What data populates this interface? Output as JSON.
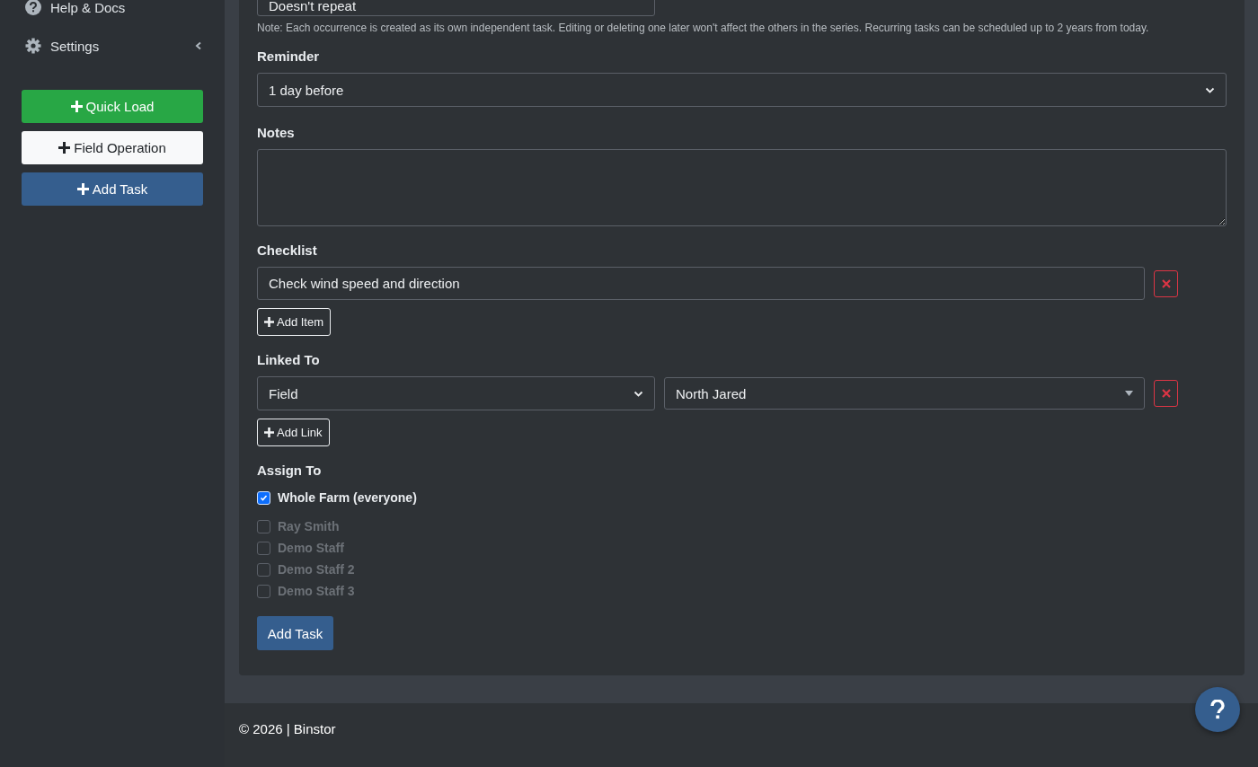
{
  "sidebar": {
    "items": [
      {
        "label": "Help & Docs"
      },
      {
        "label": "Settings",
        "expanded": false
      }
    ],
    "buttons": [
      {
        "label": "Quick Load",
        "kind": "success"
      },
      {
        "label": "Field Operation",
        "kind": "light"
      },
      {
        "label": "Add Task",
        "kind": "primary"
      }
    ]
  },
  "form": {
    "repeat": {
      "value": "Doesn't repeat"
    },
    "repeat_note": "Note: Each occurrence is created as its own independent task. Editing or deleting one later won't affect the others in the series. Recurring tasks can be scheduled up to 2 years from today.",
    "reminder": {
      "label": "Reminder",
      "value": "1 day before"
    },
    "notes": {
      "label": "Notes"
    },
    "checklist": {
      "label": "Checklist",
      "items": [
        "Check wind speed and direction"
      ],
      "add_button": "Add Item"
    },
    "linked_to": {
      "label": "Linked To",
      "links": [
        {
          "type": "Field",
          "target": "North Jared"
        }
      ],
      "add_button": "Add Link"
    },
    "assign_to": {
      "label": "Assign To",
      "options": [
        {
          "label": "Whole Farm (everyone)",
          "checked": true,
          "disabled": false
        },
        {
          "label": "Ray Smith",
          "checked": false,
          "disabled": true
        },
        {
          "label": "Demo Staff",
          "checked": false,
          "disabled": true
        },
        {
          "label": "Demo Staff 2",
          "checked": false,
          "disabled": true
        },
        {
          "label": "Demo Staff 3",
          "checked": false,
          "disabled": true
        }
      ]
    },
    "submit": "Add Task"
  },
  "footer": {
    "text": "© 2026 | Binstor"
  }
}
